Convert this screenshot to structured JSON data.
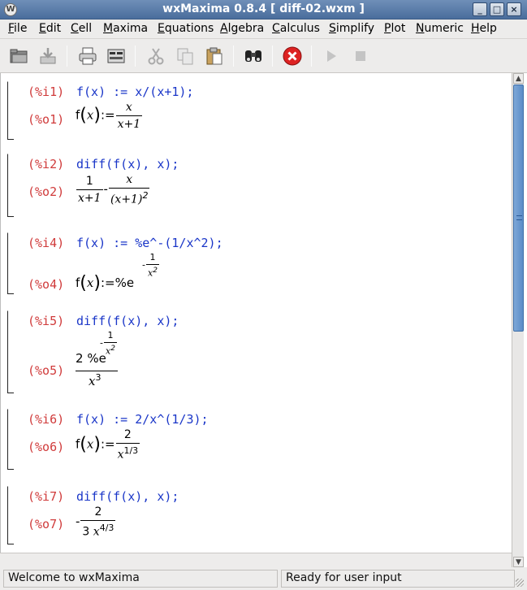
{
  "window": {
    "title": "wxMaxima 0.8.4  [ diff-02.wxm ]",
    "icons": [
      "app-icon",
      "minimize-icon",
      "maximize-icon",
      "close-icon"
    ]
  },
  "menu": [
    "File",
    "Edit",
    "Cell",
    "Maxima",
    "Equations",
    "Algebra",
    "Calculus",
    "Simplify",
    "Plot",
    "Numeric",
    "Help"
  ],
  "toolbar": {
    "icons": [
      "open-folder-icon",
      "save-icon",
      "print-icon",
      "config-icon",
      "cut-icon",
      "copy-icon",
      "paste-icon",
      "find-icon",
      "interrupt-icon",
      "play-icon",
      "stop-icon"
    ]
  },
  "cells": [
    {
      "in_label": "(%i1)",
      "in_text": "f(x) := x/(x+1);",
      "out_label": "(%o1)",
      "out": {
        "fn": "f",
        "arg": "x",
        "assign": ":=",
        "num": "x",
        "den": "x+1"
      }
    },
    {
      "in_label": "(%i2)",
      "in_text": "diff(f(x), x);",
      "out_label": "(%o2)",
      "out": {
        "n1": "1",
        "d1": "x+1",
        "minus": "-",
        "n2": "x",
        "d2": "(x+1)",
        "exp": "2"
      }
    },
    {
      "in_label": "(%i4)",
      "in_text": "f(x) := %e^-(1/x^2);",
      "out_label": "(%o4)",
      "out": {
        "fn": "f",
        "arg": "x",
        "assign": ":=",
        "base": "%e",
        "minus": "-",
        "enum": "1",
        "eden": "x",
        "eexp": "2"
      }
    },
    {
      "in_label": "(%i5)",
      "in_text": "diff(f(x), x);",
      "out_label": "(%o5)",
      "out": {
        "coef": "2",
        "base": "%e",
        "minus": "-",
        "enum": "1",
        "eden": "x",
        "eexp": "2",
        "den": "x",
        "dexp": "3"
      }
    },
    {
      "in_label": "(%i6)",
      "in_text": "f(x) := 2/x^(1/3);",
      "out_label": "(%o6)",
      "out": {
        "fn": "f",
        "arg": "x",
        "assign": ":=",
        "num": "2",
        "den": "x",
        "dexp": "1/3"
      }
    },
    {
      "in_label": "(%i7)",
      "in_text": "diff(f(x), x);",
      "out_label": "(%o7)",
      "out": {
        "minus": "-",
        "num": "2",
        "coef": "3",
        "den": "x",
        "dexp": "4/3"
      }
    }
  ],
  "status": {
    "left": "Welcome to wxMaxima",
    "right": "Ready for user input"
  }
}
